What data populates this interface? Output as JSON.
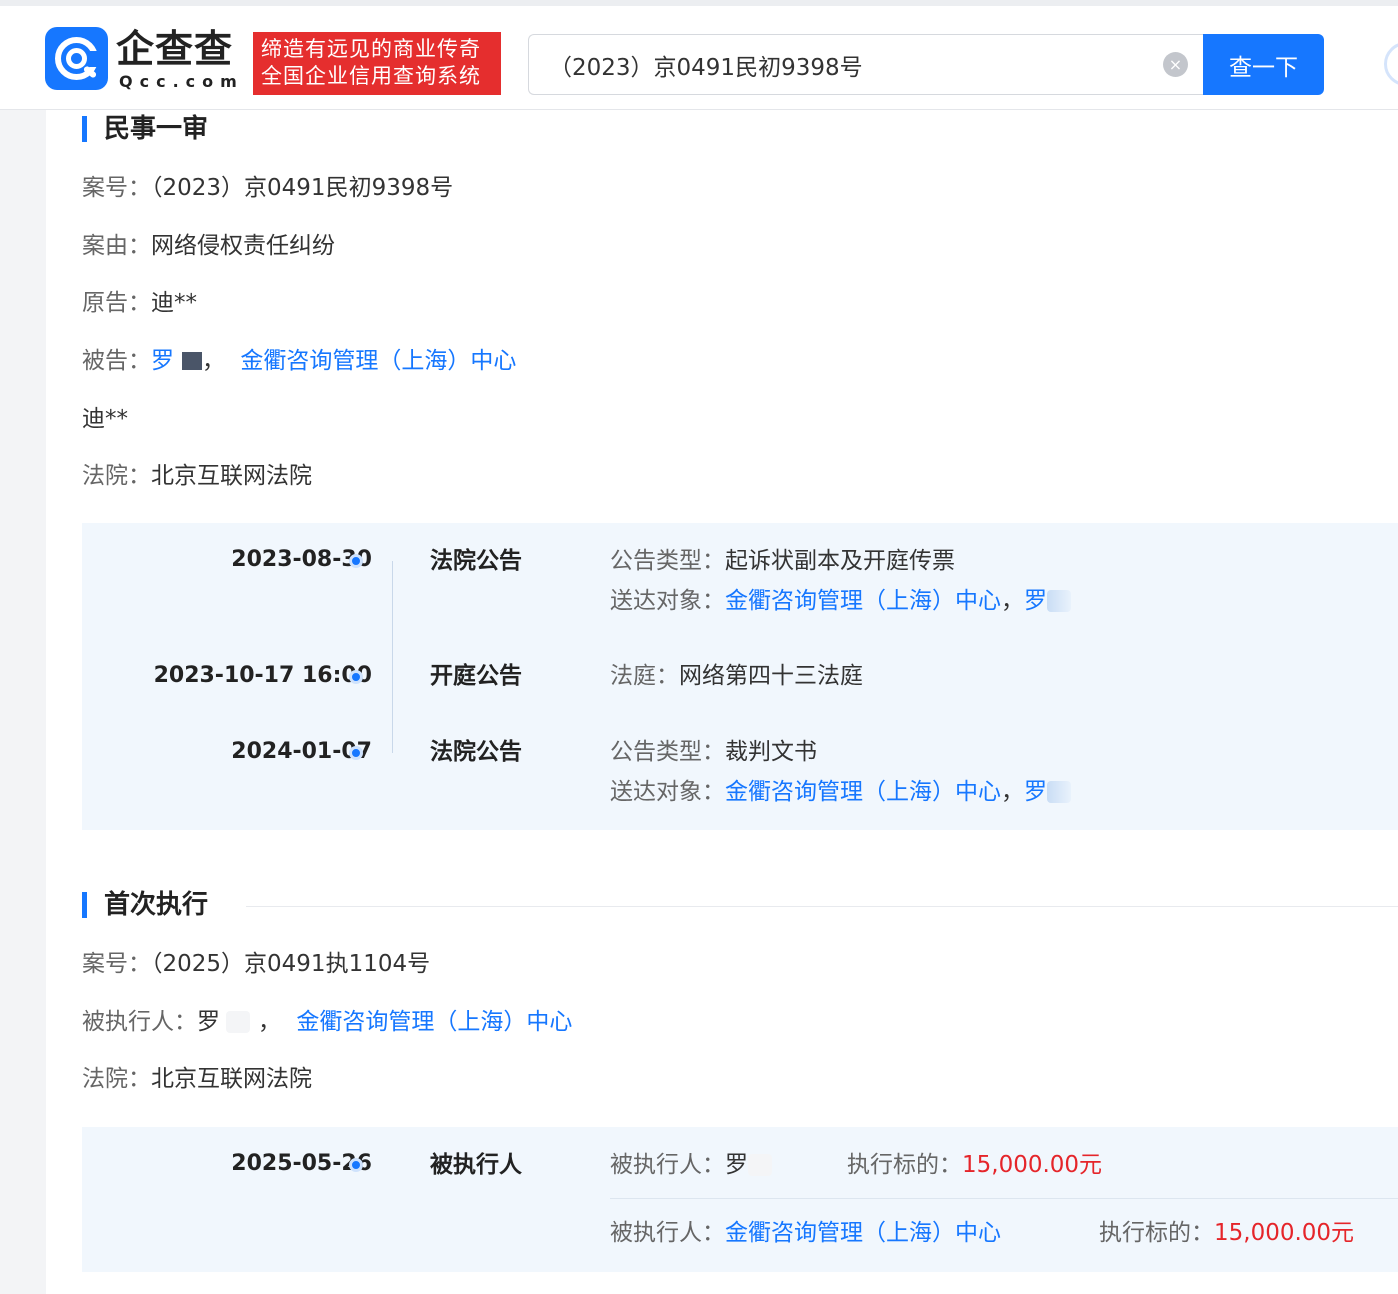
{
  "header": {
    "logo_cn": "企查查",
    "logo_en": "Qcc.com",
    "slogan_line1": "缔造有远见的商业传奇",
    "slogan_line2": "全国企业信用查询系统",
    "search_value": "（2023）京0491民初9398号",
    "clear_icon": "×",
    "search_button": "查一下"
  },
  "first_instance": {
    "title": "民事一审",
    "case_no_label": "案号：",
    "case_no": "（2023）京0491民初9398号",
    "cause_label": "案由：",
    "cause": "网络侵权责任纠纷",
    "plaintiff_label": "原告：",
    "plaintiff": "迪**",
    "defendant_label": "被告：",
    "defendant_1": "罗",
    "separator": "，",
    "defendant_2": "金衢咨询管理（上海）中心",
    "extra_party": "迪**",
    "court_label": "法院：",
    "court": "北京互联网法院",
    "timeline": [
      {
        "date": "2023-08-30",
        "type": "法院公告",
        "line1_label": "公告类型：",
        "line1_value": "起诉状副本及开庭传票",
        "line2_label": "送达对象：",
        "line2_link": "金衢咨询管理（上海）中心",
        "line2_sep": "，",
        "line2_person": "罗"
      },
      {
        "date": "2023-10-17 16:00",
        "type": "开庭公告",
        "line1_label": "法庭：",
        "line1_value": "网络第四十三法庭"
      },
      {
        "date": "2024-01-07",
        "type": "法院公告",
        "line1_label": "公告类型：",
        "line1_value": "裁判文书",
        "line2_label": "送达对象：",
        "line2_link": "金衢咨询管理（上海）中心",
        "line2_sep": "，",
        "line2_person": "罗"
      }
    ]
  },
  "execution": {
    "title": "首次执行",
    "case_no_label": "案号：",
    "case_no": "（2025）京0491执1104号",
    "executed_label": "被执行人：",
    "executed_1": "罗",
    "separator": "，",
    "executed_2": "金衢咨询管理（上海）中心",
    "court_label": "法院：",
    "court": "北京互联网法院",
    "timeline": [
      {
        "date": "2025-05-26",
        "type": "被执行人",
        "row1_label": "被执行人：",
        "row1_person": "罗",
        "row1_amount_label": "执行标的：",
        "row1_amount": "15,000.00元",
        "row2_label": "被执行人：",
        "row2_link": "金衢咨询管理（上海）中心",
        "row2_amount_label": "执行标的：",
        "row2_amount": "15,000.00元"
      }
    ]
  },
  "colors": {
    "brand_blue": "#1677ff",
    "slogan_red": "#e52e2e",
    "amount_red": "#e5252a",
    "panel_bg": "#f1f7fd"
  }
}
